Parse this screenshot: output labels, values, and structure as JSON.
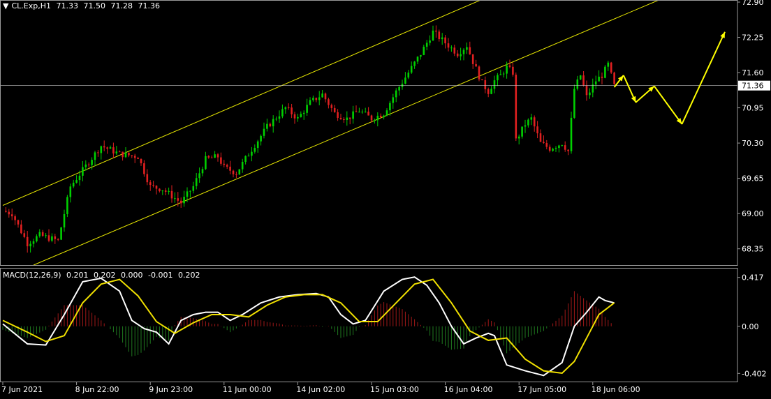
{
  "header": {
    "symbol": "CL.Exp,H1",
    "ohlc": [
      "71.33",
      "71.50",
      "71.28",
      "71.36"
    ]
  },
  "macd_header": {
    "label": "MACD(12,26,9)",
    "values": [
      "0.201",
      "0.202",
      "0.000",
      "-0.001",
      "0.202"
    ]
  },
  "colors": {
    "background": "#000000",
    "bull": "#00d000",
    "bear": "#e02020",
    "channel": "#e6e600",
    "arrows": "#ffff00",
    "macd_line": "#ffffff",
    "signal_line": "#f0e000",
    "axis_text": "#ffffff",
    "current_price_line": "#c8c8c8"
  },
  "chart_data": [
    {
      "type": "candlestick",
      "title": "",
      "current_price": 71.36,
      "current_price_label": "71.36",
      "ylim": [
        68.05,
        72.9
      ],
      "y_ticks": [
        "72.90",
        "72.25",
        "71.60",
        "70.95",
        "70.30",
        "69.65",
        "69.00",
        "68.35"
      ],
      "x_ticks": [
        "7 Jun 2021",
        "8 Jun 22:00",
        "9 Jun 23:00",
        "11 Jun 00:00",
        "14 Jun 02:00",
        "15 Jun 03:00",
        "16 Jun 04:00",
        "17 Jun 05:00",
        "18 Jun 06:00"
      ],
      "price_path": [
        [
          0,
          69.05
        ],
        [
          3,
          69.0
        ],
        [
          8,
          68.45
        ],
        [
          12,
          68.6
        ],
        [
          18,
          68.5
        ],
        [
          22,
          69.5
        ],
        [
          26,
          69.8
        ],
        [
          32,
          70.25
        ],
        [
          38,
          70.1
        ],
        [
          44,
          70.05
        ],
        [
          48,
          69.5
        ],
        [
          52,
          69.45
        ],
        [
          58,
          69.2
        ],
        [
          62,
          69.5
        ],
        [
          66,
          70.0
        ],
        [
          70,
          70.05
        ],
        [
          72,
          69.85
        ],
        [
          76,
          69.75
        ],
        [
          80,
          70.1
        ],
        [
          86,
          70.6
        ],
        [
          92,
          70.95
        ],
        [
          96,
          70.75
        ],
        [
          100,
          71.05
        ],
        [
          104,
          71.2
        ],
        [
          108,
          70.85
        ],
        [
          112,
          70.75
        ],
        [
          116,
          70.9
        ],
        [
          120,
          70.75
        ],
        [
          124,
          70.85
        ],
        [
          128,
          71.25
        ],
        [
          132,
          71.6
        ],
        [
          136,
          71.95
        ],
        [
          140,
          72.35
        ],
        [
          144,
          72.15
        ],
        [
          148,
          71.95
        ],
        [
          151,
          72.1
        ],
        [
          153,
          71.8
        ],
        [
          156,
          71.4
        ],
        [
          158,
          71.25
        ],
        [
          160,
          71.45
        ],
        [
          162,
          71.55
        ],
        [
          164,
          71.7
        ],
        [
          166,
          71.6
        ],
        [
          167,
          70.35
        ],
        [
          170,
          70.65
        ],
        [
          172,
          70.75
        ],
        [
          175,
          70.3
        ],
        [
          178,
          70.2
        ],
        [
          182,
          70.3
        ],
        [
          184,
          70.15
        ],
        [
          186,
          71.3
        ],
        [
          188,
          71.55
        ],
        [
          190,
          71.15
        ],
        [
          193,
          71.45
        ],
        [
          195,
          71.55
        ],
        [
          197,
          71.75
        ],
        [
          199,
          71.35
        ]
      ],
      "channel": {
        "upper": {
          "start": [
            0,
            69.15
          ],
          "end": [
            156,
            72.95
          ]
        },
        "lower": {
          "start": [
            10,
            68.05
          ],
          "end": [
            214,
            72.95
          ]
        }
      },
      "forecast_arrows": [
        [
          199,
          71.33
        ],
        [
          202,
          71.55
        ],
        [
          206,
          71.05
        ],
        [
          212,
          71.35
        ],
        [
          221,
          70.65
        ],
        [
          235,
          72.35
        ]
      ],
      "macd": {
        "label": "MACD(12,26,9)",
        "ylim": [
          -0.43,
          0.445
        ],
        "y_ticks": [
          "0.417",
          "0.00",
          "-0.402"
        ],
        "macd_path": [
          [
            0,
            0.02
          ],
          [
            8,
            -0.15
          ],
          [
            14,
            -0.16
          ],
          [
            20,
            0.1
          ],
          [
            26,
            0.38
          ],
          [
            32,
            0.41
          ],
          [
            38,
            0.3
          ],
          [
            42,
            0.05
          ],
          [
            46,
            -0.02
          ],
          [
            50,
            -0.05
          ],
          [
            54,
            -0.15
          ],
          [
            58,
            0.05
          ],
          [
            62,
            0.1
          ],
          [
            66,
            0.12
          ],
          [
            70,
            0.12
          ],
          [
            74,
            0.05
          ],
          [
            78,
            0.1
          ],
          [
            84,
            0.2
          ],
          [
            90,
            0.25
          ],
          [
            96,
            0.27
          ],
          [
            102,
            0.28
          ],
          [
            106,
            0.25
          ],
          [
            110,
            0.1
          ],
          [
            114,
            0.02
          ],
          [
            118,
            0.05
          ],
          [
            124,
            0.3
          ],
          [
            130,
            0.4
          ],
          [
            134,
            0.42
          ],
          [
            138,
            0.35
          ],
          [
            142,
            0.2
          ],
          [
            146,
            0.0
          ],
          [
            150,
            -0.15
          ],
          [
            154,
            -0.1
          ],
          [
            158,
            -0.06
          ],
          [
            160,
            -0.08
          ],
          [
            164,
            -0.33
          ],
          [
            170,
            -0.38
          ],
          [
            176,
            -0.42
          ],
          [
            182,
            -0.31
          ],
          [
            186,
            0.0
          ],
          [
            190,
            0.12
          ],
          [
            194,
            0.25
          ],
          [
            196,
            0.22
          ],
          [
            199,
            0.2
          ]
        ],
        "signal_path": [
          [
            0,
            0.05
          ],
          [
            8,
            -0.05
          ],
          [
            14,
            -0.13
          ],
          [
            20,
            -0.08
          ],
          [
            26,
            0.2
          ],
          [
            32,
            0.36
          ],
          [
            38,
            0.4
          ],
          [
            44,
            0.26
          ],
          [
            50,
            0.04
          ],
          [
            56,
            -0.06
          ],
          [
            62,
            0.03
          ],
          [
            68,
            0.1
          ],
          [
            74,
            0.1
          ],
          [
            80,
            0.08
          ],
          [
            86,
            0.18
          ],
          [
            92,
            0.25
          ],
          [
            98,
            0.27
          ],
          [
            104,
            0.27
          ],
          [
            110,
            0.2
          ],
          [
            116,
            0.04
          ],
          [
            122,
            0.04
          ],
          [
            128,
            0.2
          ],
          [
            134,
            0.36
          ],
          [
            140,
            0.4
          ],
          [
            146,
            0.2
          ],
          [
            152,
            -0.04
          ],
          [
            158,
            -0.12
          ],
          [
            164,
            -0.1
          ],
          [
            170,
            -0.28
          ],
          [
            176,
            -0.38
          ],
          [
            182,
            -0.4
          ],
          [
            186,
            -0.3
          ],
          [
            190,
            -0.1
          ],
          [
            194,
            0.1
          ],
          [
            199,
            0.2
          ]
        ]
      }
    }
  ]
}
